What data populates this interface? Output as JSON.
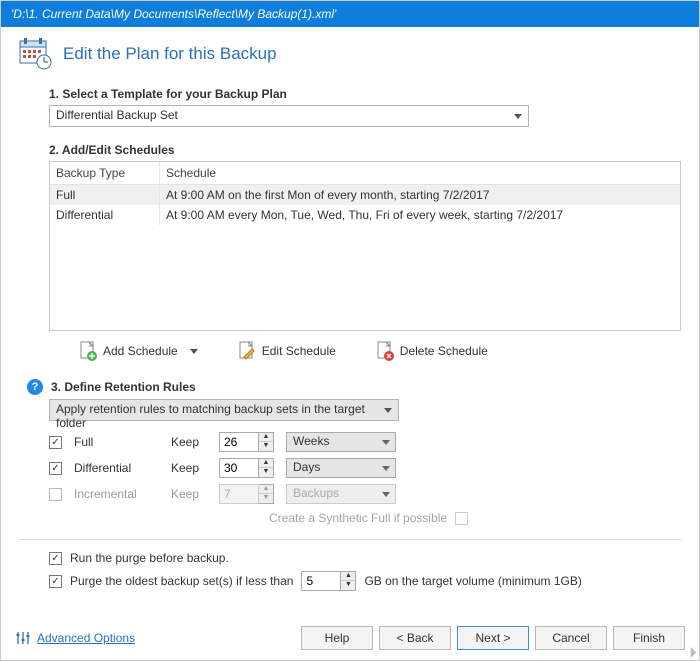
{
  "title_path": "'D:\\1. Current Data\\My Documents\\Reflect\\My Backup(1).xml'",
  "header": "Edit the Plan for this Backup",
  "step1": {
    "label": "1. Select a Template for your Backup Plan",
    "selected": "Differential Backup Set"
  },
  "step2": {
    "label": "2. Add/Edit Schedules",
    "col_type": "Backup Type",
    "col_sched": "Schedule",
    "rows": [
      {
        "type": "Full",
        "sched": "At 9:00 AM on the first Mon of every month, starting 7/2/2017"
      },
      {
        "type": "Differential",
        "sched": "At 9:00 AM every Mon, Tue, Wed, Thu, Fri of every week, starting 7/2/2017"
      }
    ],
    "add_btn": "Add Schedule",
    "edit_btn": "Edit Schedule",
    "del_btn": "Delete Schedule"
  },
  "step3": {
    "label": "3. Define Retention Rules",
    "scope": "Apply retention rules to matching backup sets in the target folder",
    "keep": "Keep",
    "rules": {
      "full": {
        "label": "Full",
        "checked": true,
        "value": "26",
        "unit": "Weeks"
      },
      "diff": {
        "label": "Differential",
        "checked": true,
        "value": "30",
        "unit": "Days"
      },
      "incr": {
        "label": "Incremental",
        "checked": false,
        "value": "7",
        "unit": "Backups"
      }
    },
    "synthetic": "Create a Synthetic Full if possible"
  },
  "options": {
    "run_purge": "Run the purge before backup.",
    "purge_oldest_prefix": "Purge the oldest backup set(s) if less than",
    "purge_value": "5",
    "purge_oldest_suffix": "GB on the target volume (minimum 1GB)"
  },
  "footer": {
    "advanced": "Advanced Options",
    "help": "Help",
    "back": "< Back",
    "next": "Next >",
    "cancel": "Cancel",
    "finish": "Finish"
  }
}
